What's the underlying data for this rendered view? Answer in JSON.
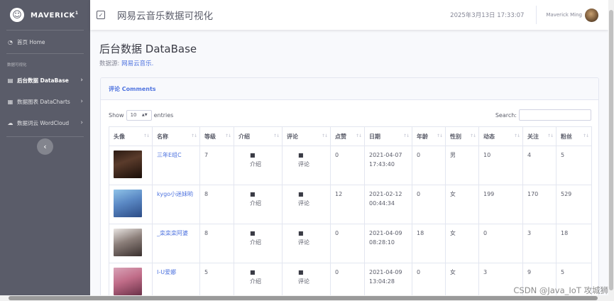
{
  "brand": {
    "name": "MAVERICK",
    "sup": "1",
    "icon": "smile-icon"
  },
  "sidebar": {
    "home": {
      "label": "首页 Home",
      "icon": "tachometer-icon"
    },
    "heading": "数据可视化",
    "items": [
      {
        "label": "后台数据 DataBase",
        "icon": "table-icon",
        "active": true
      },
      {
        "label": "数据图表 DataCharts",
        "icon": "chart-icon",
        "active": false
      },
      {
        "label": "数据词云 WordCloud",
        "icon": "cloud-icon",
        "active": false
      }
    ]
  },
  "topbar": {
    "title": "网易云音乐数据可视化",
    "datetime": "2025年3月13日 17:33:07",
    "user": "Maverick Ming"
  },
  "page": {
    "title": "后台数据 DataBase",
    "source_prefix": "数据源:",
    "source_link": "网易云音乐."
  },
  "card": {
    "title": "评论 Comments",
    "show_label": "Show",
    "entries_value": "10",
    "entries_label": "entries",
    "search_label": "Search:"
  },
  "table": {
    "columns": [
      "头像",
      "名称",
      "等级",
      "介绍",
      "评论",
      "点赞",
      "日期",
      "年龄",
      "性别",
      "动态",
      "关注",
      "粉丝"
    ],
    "intro_label": "介绍",
    "comment_label": "评论",
    "rows": [
      {
        "name": "三年E组C",
        "level": "7",
        "likes": "0",
        "date": "2021-04-07",
        "time": "17:43:40",
        "age": "0",
        "gender": "男",
        "events": "10",
        "follows": "4",
        "fans": "5"
      },
      {
        "name": "kygo小迷妹哟",
        "level": "8",
        "likes": "12",
        "date": "2021-02-12",
        "time": "00:44:34",
        "age": "0",
        "gender": "女",
        "events": "199",
        "follows": "170",
        "fans": "529"
      },
      {
        "name": "_栾栾栾阿婆",
        "level": "8",
        "likes": "0",
        "date": "2021-04-09",
        "time": "08:28:10",
        "age": "18",
        "gender": "女",
        "events": "0",
        "follows": "3",
        "fans": "18"
      },
      {
        "name": "I-U爱娜",
        "level": "5",
        "likes": "0",
        "date": "2021-04-09",
        "time": "13:04:28",
        "age": "0",
        "gender": "女",
        "events": "3",
        "follows": "9",
        "fans": "5"
      }
    ]
  },
  "watermark": "CSDN @Java_IoT 攻城狮"
}
